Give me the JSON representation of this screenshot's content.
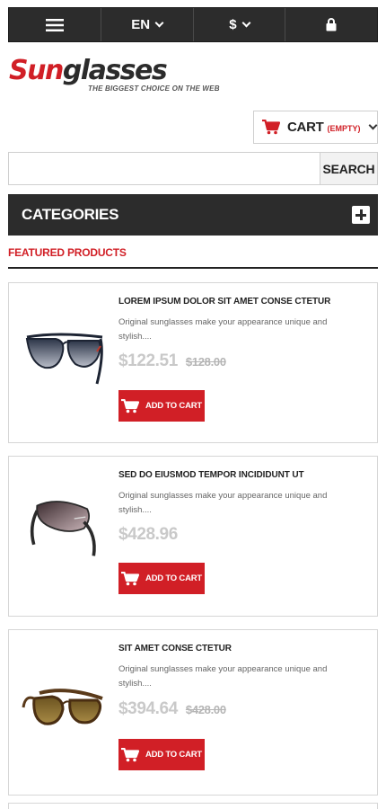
{
  "topbar": {
    "menu_icon": "hamburger-icon",
    "language": "EN",
    "currency": "$",
    "account_icon": "lock-icon"
  },
  "logo": {
    "brand_part1": "Sun",
    "brand_part2": "glasses",
    "tagline": "THE BIGGEST CHOICE ON THE WEB"
  },
  "cart": {
    "icon": "cart-icon",
    "label": "CART",
    "status": "(EMPTY)"
  },
  "search": {
    "value": "",
    "button_label": "SEARCH"
  },
  "categories": {
    "title": "CATEGORIES",
    "toggle_icon": "plus-icon"
  },
  "featured": {
    "title": "FEATURED PRODUCTS"
  },
  "products": [
    {
      "name": "LOREM IPSUM DOLOR SIT AMET CONSE CTETUR",
      "description": "Original sunglasses make your appearance unique and stylish....",
      "price": "$122.51",
      "old_price": "$128.00",
      "add_label": "ADD TO CART"
    },
    {
      "name": "SED DO EIUSMOD TEMPOR INCIDIDUNT UT",
      "description": "Original sunglasses make your appearance unique and stylish....",
      "price": "$428.96",
      "old_price": "",
      "add_label": "ADD TO CART"
    },
    {
      "name": "SIT AMET CONSE CTETUR",
      "description": "Original sunglasses make your appearance unique and stylish....",
      "price": "$394.64",
      "old_price": "$428.00",
      "add_label": "ADD TO CART"
    }
  ],
  "colors": {
    "accent": "#d11f26",
    "dark_bar": "#2c2c2c"
  }
}
